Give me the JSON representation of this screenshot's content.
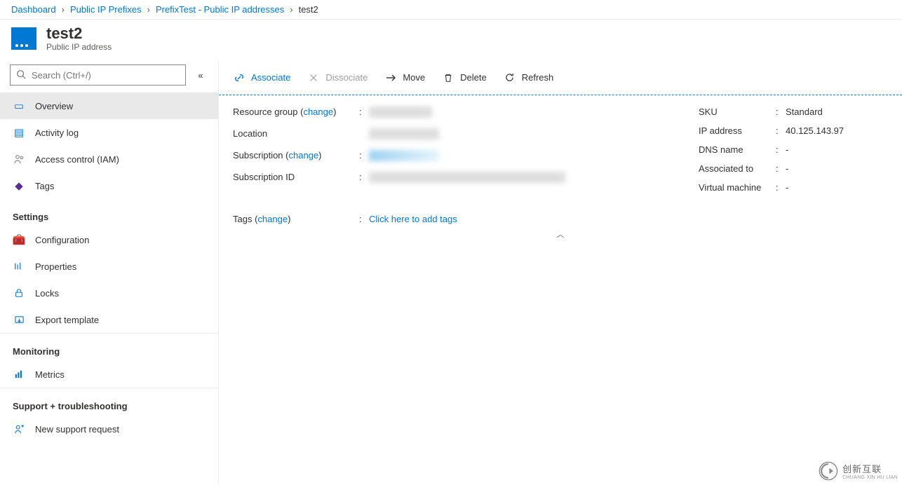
{
  "breadcrumb": [
    {
      "label": "Dashboard",
      "link": true
    },
    {
      "label": "Public IP Prefixes",
      "link": true
    },
    {
      "label": "PrefixTest - Public IP addresses",
      "link": true
    },
    {
      "label": "test2",
      "link": false
    }
  ],
  "header": {
    "title": "test2",
    "subtitle": "Public IP address"
  },
  "search": {
    "placeholder": "Search (Ctrl+/)"
  },
  "nav": {
    "items": [
      {
        "label": "Overview",
        "icon": "overview",
        "color": "#0078d4",
        "selected": true
      },
      {
        "label": "Activity log",
        "icon": "log",
        "color": "#0078d4"
      },
      {
        "label": "Access control (IAM)",
        "icon": "iam",
        "color": "#8a8886"
      },
      {
        "label": "Tags",
        "icon": "tag",
        "color": "#5c2d91"
      }
    ],
    "sections": [
      {
        "title": "Settings",
        "items": [
          {
            "label": "Configuration",
            "icon": "config",
            "color": "#d83b01"
          },
          {
            "label": "Properties",
            "icon": "props",
            "color": "#0078d4"
          },
          {
            "label": "Locks",
            "icon": "lock",
            "color": "#0078d4"
          },
          {
            "label": "Export template",
            "icon": "export",
            "color": "#0078d4"
          }
        ]
      },
      {
        "title": "Monitoring",
        "items": [
          {
            "label": "Metrics",
            "icon": "metrics",
            "color": "#0078d4"
          }
        ]
      },
      {
        "title": "Support + troubleshooting",
        "items": [
          {
            "label": "New support request",
            "icon": "support",
            "color": "#0078d4"
          }
        ]
      }
    ]
  },
  "toolbar": {
    "associate": "Associate",
    "dissociate": "Dissociate",
    "move": "Move",
    "delete": "Delete",
    "refresh": "Refresh"
  },
  "essentials": {
    "left": [
      {
        "key": "Resource group",
        "change": "change",
        "valueBlur": "w1"
      },
      {
        "key": "Location",
        "valueBlur": "w2"
      },
      {
        "key": "Subscription",
        "change": "change",
        "valueBlur": "w3"
      },
      {
        "key": "Subscription ID",
        "valueBlur": "w4"
      }
    ],
    "right": [
      {
        "key": "SKU",
        "value": "Standard"
      },
      {
        "key": "IP address",
        "value": "40.125.143.97"
      },
      {
        "key": "DNS name",
        "value": "-"
      },
      {
        "key": "Associated to",
        "value": "-"
      },
      {
        "key": "Virtual machine",
        "value": "-"
      }
    ],
    "change_label": "change",
    "tags_label": "Tags",
    "tags_cta": "Click here to add tags"
  },
  "watermark": {
    "cn": "创新互联",
    "en": "CHUANG XIN HU LIAN"
  }
}
